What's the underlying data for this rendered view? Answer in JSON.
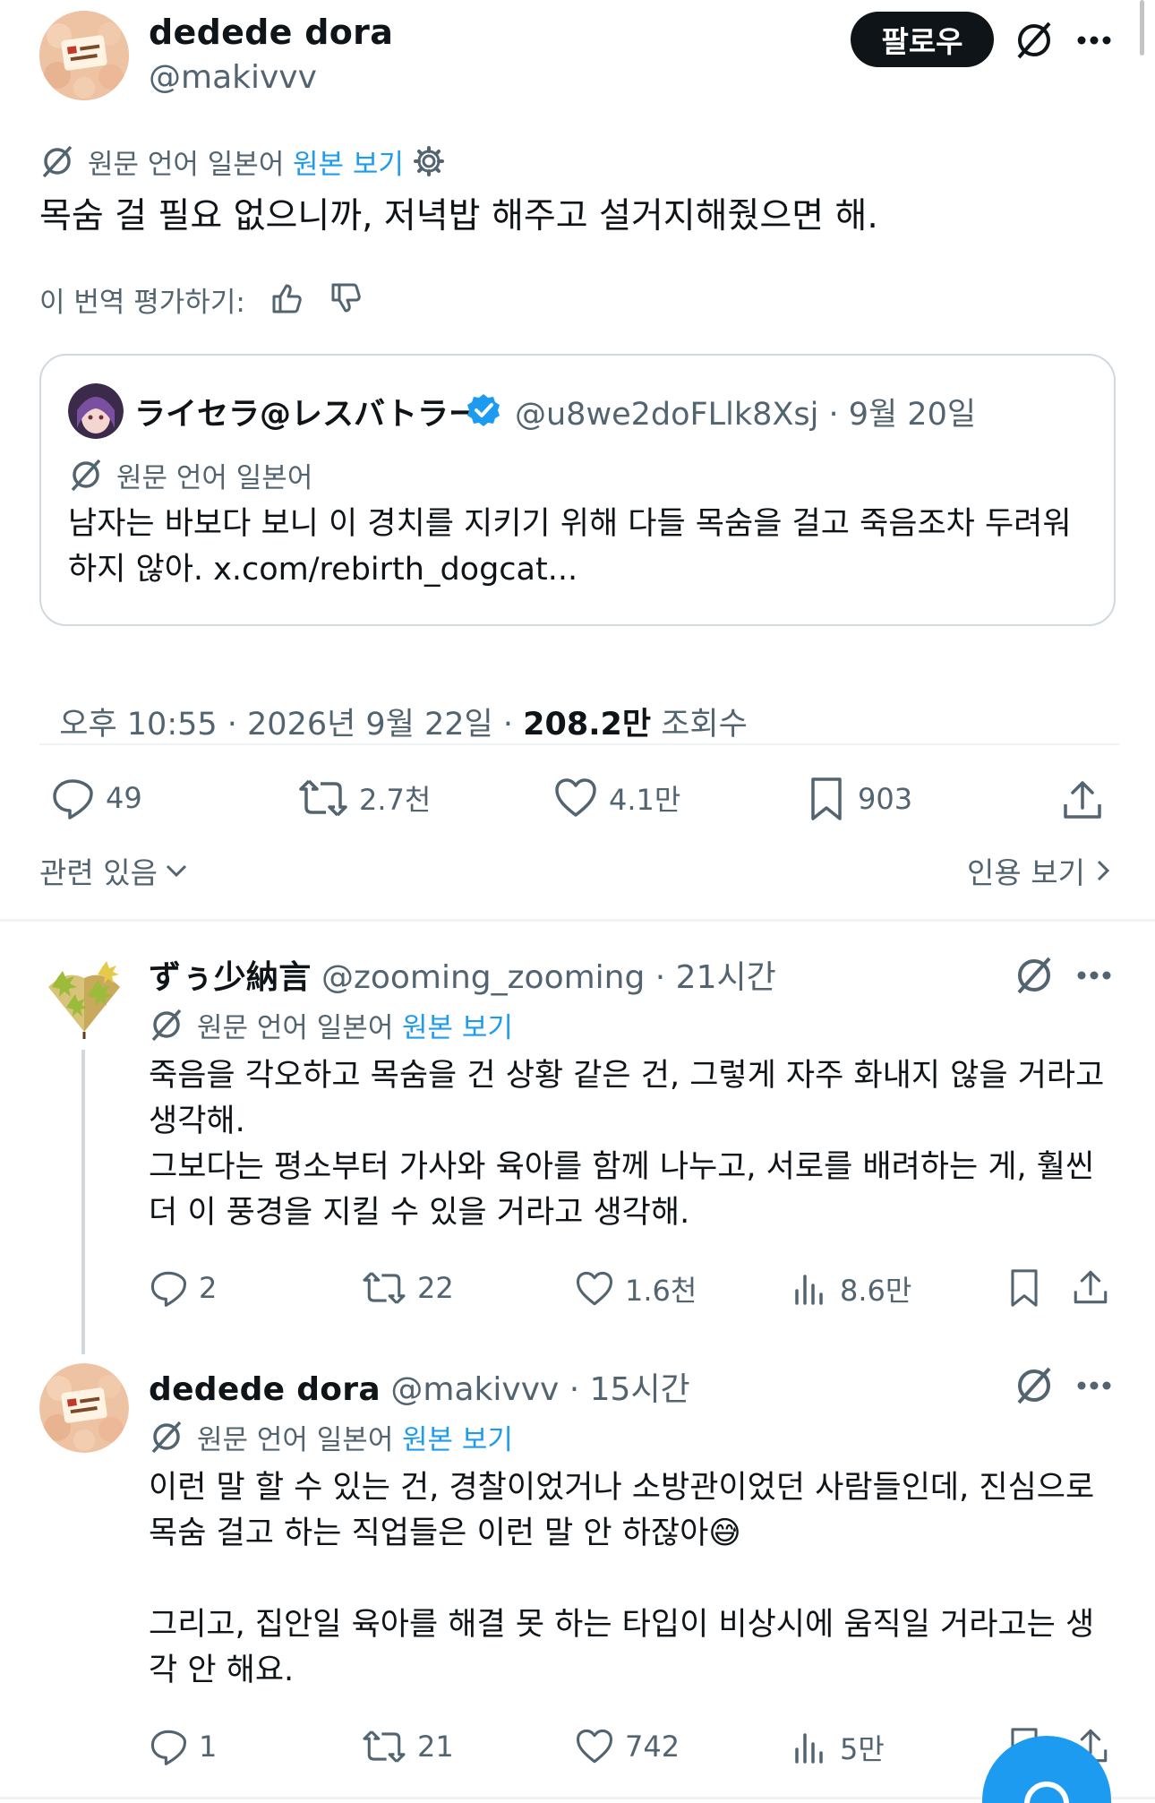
{
  "main_tweet": {
    "name": "dedede dora",
    "handle": "@makivvv",
    "follow_label": "팔로우",
    "translation": {
      "source_label": "원문 언어 일본어",
      "view_original": "원본 보기"
    },
    "text": "목숨 걸 필요 없으니까, 저녁밥 해주고 설거지해줬으면 해.",
    "rate_translation": "이 번역 평가하기:",
    "quote": {
      "name": "ライセラ@レスバトラー",
      "handle_date": "@u8we2doFLlk8Xsj · 9월 20일",
      "source_label": "원문 언어 일본어",
      "text_line1": "남자는 바보다 보니 이 경치를 지키기 위해 다들 목숨을 걸고 죽음조차 두려워",
      "text_line2": "하지 않아. x.com/rebirth_dogcat..."
    },
    "meta_time": "오후 10:55 · 2026년 9월 22일 · ",
    "views_count": "208.2만",
    "views_label": " 조회수",
    "actions": {
      "replies": "49",
      "retweets": "2.7천",
      "likes": "4.1만",
      "bookmarks": "903"
    },
    "related_label": "관련 있음",
    "quotes_label": "인용 보기"
  },
  "replies": [
    {
      "name": "ずぅ少納言",
      "handle_time": "@zooming_zooming · 21시간",
      "source_label": "원문 언어 일본어",
      "view_original": "원본 보기",
      "lines": [
        "죽음을 각오하고 목숨을 건 상황 같은 건, 그렇게 자주 화내지 않을 거라고",
        "생각해.",
        "그보다는 평소부터 가사와 육아를 함께 나누고, 서로를 배려하는 게, 훨씬",
        "더 이 풍경을 지킬 수 있을 거라고 생각해."
      ],
      "actions": {
        "replies": "2",
        "retweets": "22",
        "likes": "1.6천",
        "views": "8.6만"
      }
    },
    {
      "name": "dedede dora",
      "handle_time": "@makivvv · 15시간",
      "source_label": "원문 언어 일본어",
      "view_original": "원본 보기",
      "lines": [
        "이런 말 할 수 있는 건, 경찰이었거나 소방관이었던 사람들인데, 진심으로",
        "목숨 걸고 하는 직업들은 이런 말 안 하잖아😅",
        "",
        "그리고, 집안일 육아를 해결 못 하는 타입이 비상시에 움직일 거라고는 생",
        "각 안 해요."
      ],
      "actions": {
        "replies": "1",
        "retweets": "21",
        "likes": "742",
        "views": "5만"
      }
    }
  ],
  "colors": {
    "accent": "#1d9bf0",
    "text": "#0f1419",
    "secondary": "#536471",
    "border": "#cfd9de"
  },
  "icons": [
    "translate-icon",
    "gear-icon",
    "thumbs-up-icon",
    "thumbs-down-icon",
    "verified-badge-icon",
    "reply-icon",
    "retweet-icon",
    "like-icon",
    "bookmark-icon",
    "share-icon",
    "views-icon",
    "more-icon",
    "chevron-down-icon",
    "chevron-right-icon"
  ]
}
